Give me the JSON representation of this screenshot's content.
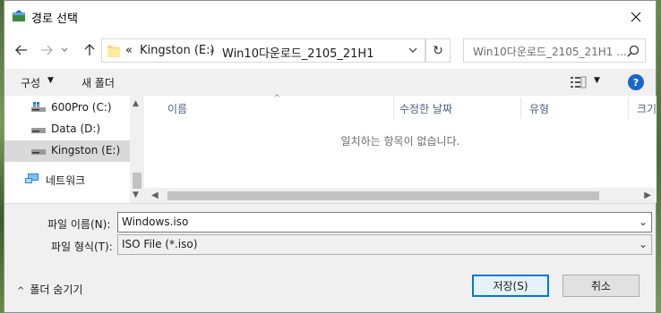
{
  "window": {
    "title": "경로 선택"
  },
  "address": {
    "overflow": "«",
    "crumbs": [
      "Kingston (E:)",
      "Win10다운로드_2105_21H1"
    ]
  },
  "search": {
    "placeholder": "Win10다운로드_2105_21H1 ..."
  },
  "toolbar": {
    "organize": "구성",
    "new_folder": "새 폴더"
  },
  "nav_pane": {
    "items": [
      {
        "label": "600Pro (C:)",
        "icon": "windows-drive-icon"
      },
      {
        "label": "Data (D:)",
        "icon": "drive-icon"
      },
      {
        "label": "Kingston (E:)",
        "icon": "drive-icon",
        "selected": true
      },
      {
        "label": "네트워크",
        "icon": "network-icon"
      }
    ]
  },
  "file_list": {
    "columns": [
      "이름",
      "수정한 날짜",
      "유형",
      "크기"
    ],
    "empty_message": "일치하는 항목이 없습니다."
  },
  "form": {
    "filename_label": "파일 이름(N):",
    "filename_value": "Windows.iso",
    "filetype_label": "파일 형식(T):",
    "filetype_value": "ISO File (*.iso)"
  },
  "footer": {
    "hide_folders": "폴더 숨기기",
    "save": "저장(S)",
    "cancel": "취소"
  },
  "colors": {
    "accent": "#0078d7",
    "help": "#1a66c9",
    "column_header": "#4d6082"
  }
}
